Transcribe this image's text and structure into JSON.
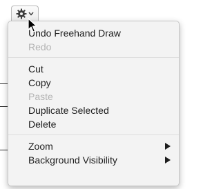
{
  "toolbar": {
    "action_menu_icon": "gear-icon",
    "dropdown_icon": "chevron-down-icon"
  },
  "menu": {
    "undo": {
      "label": "Undo Freehand Draw",
      "enabled": true
    },
    "redo": {
      "label": "Redo",
      "enabled": false
    },
    "cut": {
      "label": "Cut",
      "enabled": true
    },
    "copy": {
      "label": "Copy",
      "enabled": true
    },
    "paste": {
      "label": "Paste",
      "enabled": false
    },
    "duplicate": {
      "label": "Duplicate Selected",
      "enabled": true
    },
    "delete": {
      "label": "Delete",
      "enabled": true
    },
    "zoom": {
      "label": "Zoom",
      "has_submenu": true
    },
    "background_visibility": {
      "label": "Background Visibility",
      "has_submenu": true
    }
  },
  "colors": {
    "menu_background": "#f3f3f3",
    "text": "#1d1d1d",
    "disabled_text": "#b3b3b3"
  }
}
